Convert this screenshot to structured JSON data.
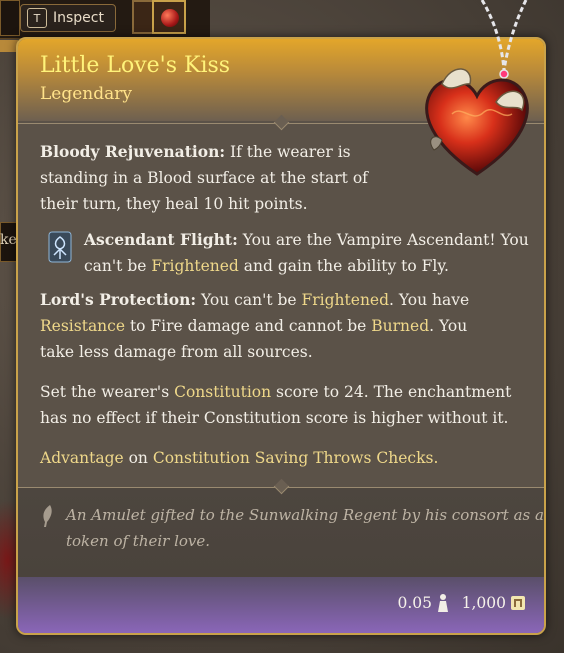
{
  "top_bar": {
    "inspect_key": "T",
    "inspect_label": "Inspect",
    "fragment_text": "ke"
  },
  "item": {
    "name": "Little Love's Kiss",
    "rarity": "Legendary",
    "icon": "heart-amulet-icon"
  },
  "effects": {
    "p1": {
      "heading": "Bloody Rejuvenation:",
      "l1": " If the wearer is",
      "l2": "standing in a Blood surface at the start of",
      "l3": "their turn, they heal 10 hit points."
    },
    "p2": {
      "heading": "Ascendant Flight:",
      "l1": " You are the Vampire Ascendant! You",
      "l2a": "can't be ",
      "l2b": "Frightened",
      "l2c": " and gain the ability to Fly."
    },
    "p3": {
      "heading": "Lord's Protection:",
      "l1a": " You can't be ",
      "l1b": "Frightened",
      "l1c": ". You have",
      "l2a": "Resistance",
      "l2b": " to Fire damage and cannot be ",
      "l2c": "Burned",
      "l2d": ". You",
      "l3": "take  less damage from all sources."
    },
    "p4": {
      "l1a": "Set the wearer's ",
      "l1b": "Constitution",
      "l1c": " score to 24. The enchantment",
      "l2": "has no effect if their Constitution score is higher without it."
    },
    "p5": {
      "a": "Advantage",
      "b": " on ",
      "c": "Constitution Saving Throws Checks."
    }
  },
  "lore": {
    "l1": "An Amulet gifted to the Sunwalking Regent by his consort as a",
    "l2": "token of their love."
  },
  "footer": {
    "weight": "0.05",
    "value": "1,000"
  },
  "colors": {
    "title": "#fff37a",
    "keyword": "#efd88a",
    "border": "#c9a24a",
    "footer_accent": "#8a66b8"
  }
}
